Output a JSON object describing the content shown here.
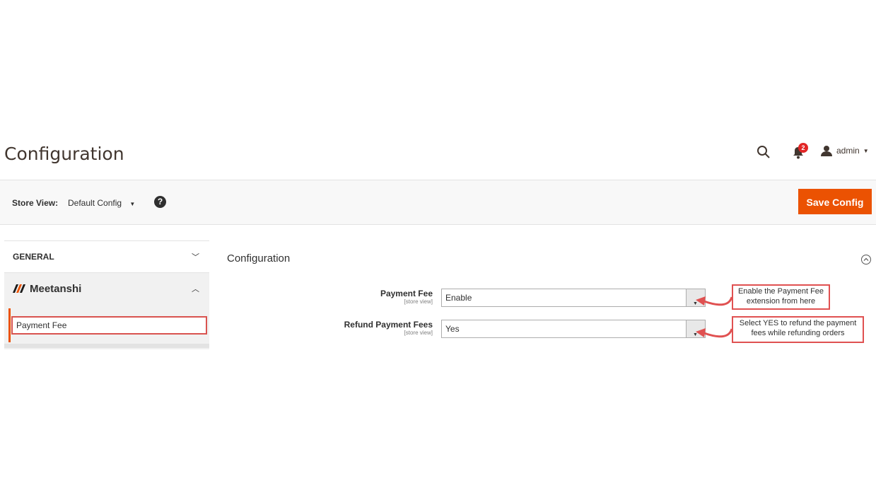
{
  "page": {
    "title": "Configuration"
  },
  "header": {
    "badge_count": "2",
    "user_name": "admin"
  },
  "store_view": {
    "label": "Store View:",
    "value": "Default Config",
    "help": "?"
  },
  "toolbar": {
    "save_label": "Save Config"
  },
  "sidebar": {
    "general": "GENERAL",
    "meetanshi": "Meetanshi",
    "sub_item": "Payment Fee"
  },
  "section": {
    "title": "Configuration"
  },
  "fields": [
    {
      "label": "Payment Fee",
      "scope": "[store view]",
      "value": "Enable"
    },
    {
      "label": "Refund Payment Fees",
      "scope": "[store view]",
      "value": "Yes"
    }
  ],
  "callouts": [
    {
      "line1": "Enable the Payment Fee",
      "line2": "extension from here"
    },
    {
      "line1": "Select YES to refund the payment",
      "line2": "fees while refunding orders"
    }
  ],
  "colors": {
    "accent": "#eb5202",
    "callout_border": "#e05151",
    "badge": "#e22626"
  }
}
